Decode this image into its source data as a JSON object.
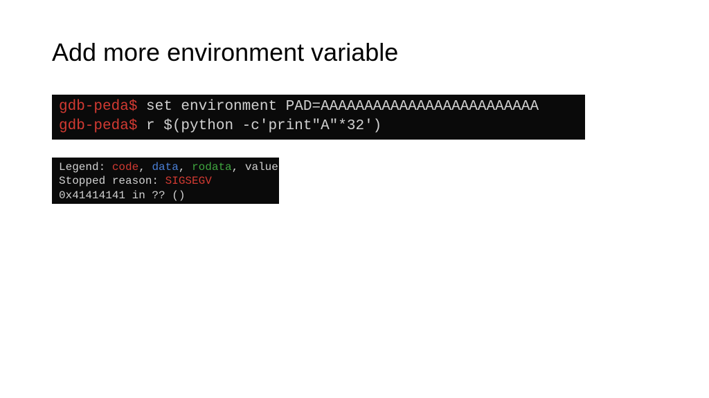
{
  "slide": {
    "title": "Add more environment variable"
  },
  "terminal1": {
    "line1": {
      "prompt": "gdb-peda$",
      "command": " set environment PAD=AAAAAAAAAAAAAAAAAAAAAAAAA"
    },
    "line2": {
      "prompt": "gdb-peda$",
      "command": " r $(python -c'print\"A\"*32')"
    }
  },
  "terminal2": {
    "legend": {
      "label": "Legend:",
      "code": " code",
      "sep1": ", ",
      "data": "data",
      "sep2": ", ",
      "rodata": "rodata",
      "sep3": ", ",
      "value": "value"
    },
    "stopped": {
      "label": "Stopped reason: ",
      "signal": "SIGSEGV"
    },
    "address": "0x41414141 in ?? ()"
  }
}
